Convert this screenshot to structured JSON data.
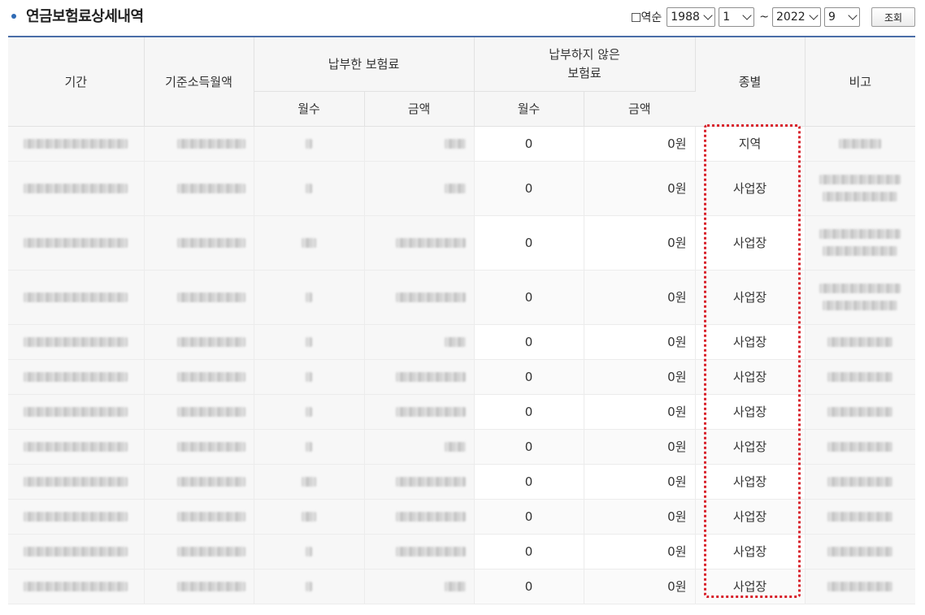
{
  "title": "연금보험료상세내역",
  "filter": {
    "reverse_label": "역순",
    "start_year": "1988",
    "start_month": "1",
    "separator": "~",
    "end_year": "2022",
    "end_month": "9",
    "search_button": "조회"
  },
  "table": {
    "headers": {
      "period": "기간",
      "base_income": "기준소득월액",
      "paid_group": "납부한 보험료",
      "unpaid_group": "납부하지 않은 보험료",
      "paid_months": "월수",
      "paid_amount": "금액",
      "unpaid_months": "월수",
      "unpaid_amount": "금액",
      "type": "종별",
      "note": "비고"
    },
    "rows": [
      {
        "unpaid_months": "0",
        "unpaid_amount": "0원",
        "type": "지역"
      },
      {
        "unpaid_months": "0",
        "unpaid_amount": "0원",
        "type": "사업장"
      },
      {
        "unpaid_months": "0",
        "unpaid_amount": "0원",
        "type": "사업장"
      },
      {
        "unpaid_months": "0",
        "unpaid_amount": "0원",
        "type": "사업장"
      },
      {
        "unpaid_months": "0",
        "unpaid_amount": "0원",
        "type": "사업장"
      },
      {
        "unpaid_months": "0",
        "unpaid_amount": "0원",
        "type": "사업장"
      },
      {
        "unpaid_months": "0",
        "unpaid_amount": "0원",
        "type": "사업장"
      },
      {
        "unpaid_months": "0",
        "unpaid_amount": "0원",
        "type": "사업장"
      },
      {
        "unpaid_months": "0",
        "unpaid_amount": "0원",
        "type": "사업장"
      },
      {
        "unpaid_months": "0",
        "unpaid_amount": "0원",
        "type": "사업장"
      },
      {
        "unpaid_months": "0",
        "unpaid_amount": "0원",
        "type": "사업장"
      },
      {
        "unpaid_months": "0",
        "unpaid_amount": "0원",
        "type": "사업장"
      }
    ]
  },
  "colors": {
    "accent": "#4a6ea8",
    "highlight": "#d8202a",
    "header_bg": "#f6f6f6"
  }
}
